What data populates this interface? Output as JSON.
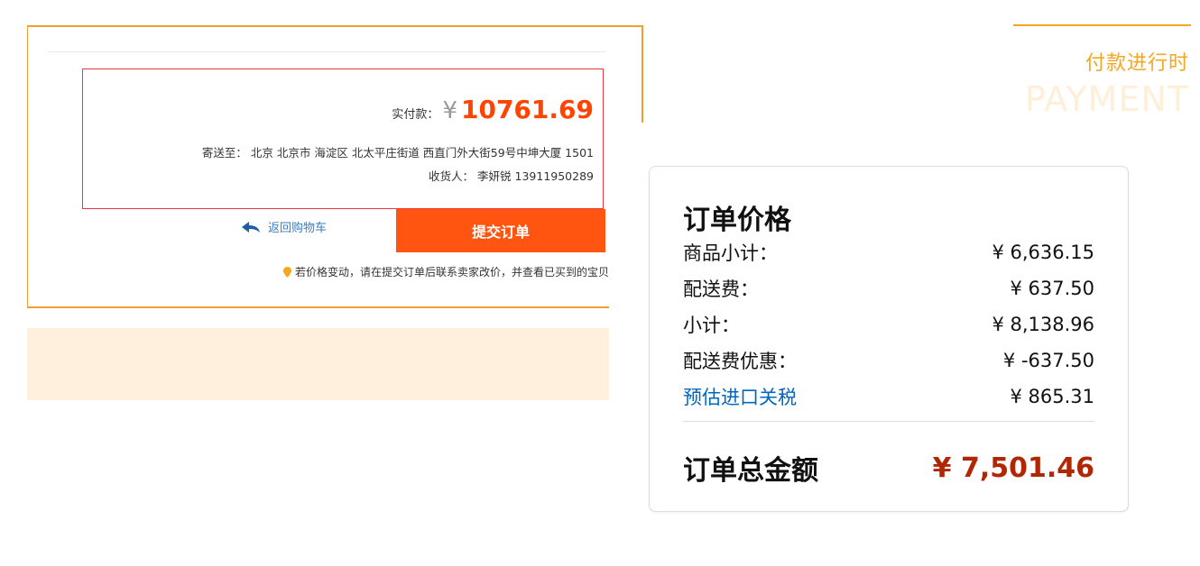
{
  "checkout": {
    "pay_label": "实付款：",
    "currency_symbol": "¥",
    "pay_amount": "10761.69",
    "address_label": "寄送至：",
    "address": "北京 北京市 海淀区 北太平庄街道 西直门外大街59号中坤大厦 1501",
    "receiver_label": "收货人：",
    "receiver": "李妍锐 13911950289",
    "back_link": "返回购物车",
    "submit_button": "提交订单",
    "notice": "若价格变动，请在提交订单后联系卖家改价，并查看已买到的宝贝"
  },
  "heading": {
    "cn": "付款进行时",
    "en": "PAYMENT"
  },
  "summary": {
    "title": "订单价格",
    "rows": [
      {
        "label": "商品小计：",
        "value": "¥ 6,636.15"
      },
      {
        "label": "配送费：",
        "value": "¥ 637.50"
      },
      {
        "label": "小计：",
        "value": "¥ 8,138.96"
      },
      {
        "label": "配送费优惠：",
        "value": "¥ -637.50"
      },
      {
        "label": "预估进口关税",
        "value": "¥ 865.31"
      }
    ],
    "total_label": "订单总金额",
    "total_value": "¥ 7,501.46"
  },
  "colors": {
    "accent_orange": "#f5a623",
    "price_orange": "#ff4400",
    "submit_bg": "#ff5511",
    "total_red": "#b12704",
    "link_blue": "#0066c0"
  }
}
